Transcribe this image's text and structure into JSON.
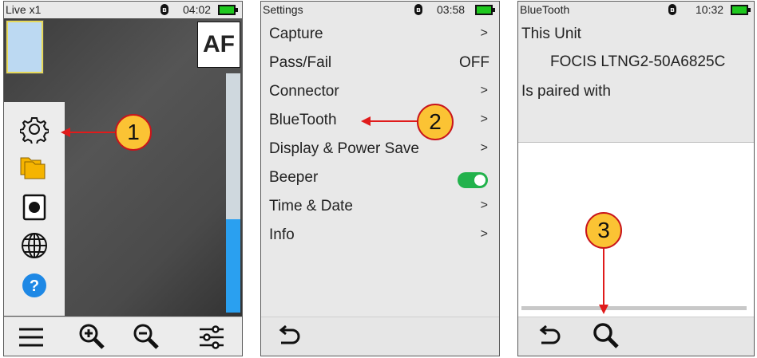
{
  "panel1": {
    "status": {
      "title": "Live x1",
      "bluetooth_icon": "bluetooth-icon",
      "time": "04:02"
    },
    "af_label": "AF",
    "scroll_fraction": 0.39,
    "side_menu": [
      {
        "icon": "gear-icon"
      },
      {
        "icon": "folders-icon"
      },
      {
        "icon": "record-icon"
      },
      {
        "icon": "globe-icon"
      },
      {
        "icon": "help-icon",
        "label": "?"
      }
    ],
    "bottom_toolbar": [
      {
        "icon": "hamburger-menu-icon"
      },
      {
        "icon": "zoom-in-icon"
      },
      {
        "icon": "zoom-out-icon"
      },
      {
        "icon": "sliders-icon"
      }
    ],
    "callout": "1"
  },
  "panel2": {
    "status": {
      "title": "Settings",
      "time": "03:58"
    },
    "menu": [
      {
        "label": "Capture",
        "value": ">"
      },
      {
        "label": "Pass/Fail",
        "value": "OFF"
      },
      {
        "label": "Connector",
        "value": ">"
      },
      {
        "label": "BlueTooth",
        "value": ">"
      },
      {
        "label": "Display & Power Save",
        "value": ">"
      },
      {
        "label": "Beeper",
        "toggle": true
      },
      {
        "label": "Time & Date",
        "value": ">"
      },
      {
        "label": "Info",
        "value": ">"
      }
    ],
    "bottom_toolbar": [
      {
        "icon": "back-arrow-icon"
      }
    ],
    "callout": "2"
  },
  "panel3": {
    "status": {
      "title": "BlueTooth",
      "time": "10:32"
    },
    "this_unit_label": "This Unit",
    "unit_id": "FOCIS LTNG2-50A6825C",
    "paired_label": "Is paired with",
    "bottom_toolbar": [
      {
        "icon": "back-arrow-icon"
      },
      {
        "icon": "search-icon"
      }
    ],
    "callout": "3"
  },
  "colors": {
    "callout_fill": "#fbc334",
    "callout_border": "#c9151b",
    "arrow": "#e01b1b",
    "toggle_on": "#22b24c",
    "battery": "#1ec81e",
    "scroll_thumb": "#2aa0f0"
  }
}
